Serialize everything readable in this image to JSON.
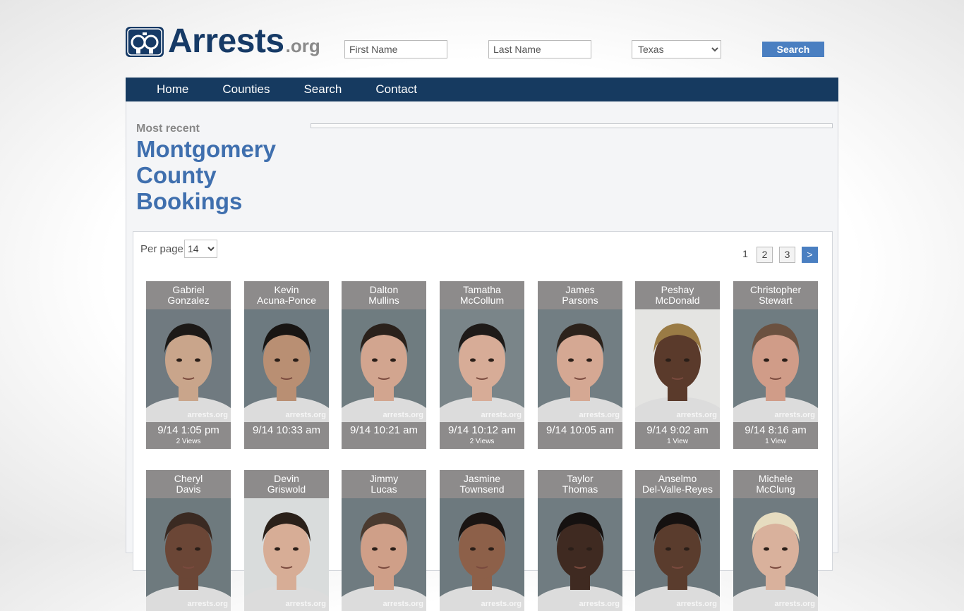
{
  "header": {
    "logo_word": "Arrests",
    "logo_tld": ".org",
    "first_name_placeholder": "First Name",
    "last_name_placeholder": "Last Name",
    "state_selected": "Texas",
    "search_label": "Search"
  },
  "nav": [
    "Home",
    "Counties",
    "Search",
    "Contact"
  ],
  "section": {
    "eyebrow": "Most recent",
    "title_lines": [
      "Montgomery",
      "County",
      "Bookings"
    ]
  },
  "controls": {
    "per_page_label": "Per page",
    "per_page_value": "14",
    "pages": [
      "1",
      "2",
      "3"
    ],
    "next_label": ">"
  },
  "watermark": "arrests.org",
  "colors": {
    "brand_navy": "#163a66",
    "accent_blue": "#4a7fc1",
    "title_blue": "#3f6fae",
    "card_gray": "#8d8b8b"
  },
  "bookings": [
    {
      "first": "Gabriel",
      "last": "Gonzalez",
      "time": "9/14 1:05 pm",
      "views": "2 Views",
      "bg": "#707a80",
      "skin": "#c9a58b",
      "hair": "#1c1917"
    },
    {
      "first": "Kevin",
      "last": "Acuna-Ponce",
      "time": "9/14 10:33 am",
      "views": "",
      "bg": "#6d7a80",
      "skin": "#b98f73",
      "hair": "#181513"
    },
    {
      "first": "Dalton",
      "last": "Mullins",
      "time": "9/14 10:21 am",
      "views": "",
      "bg": "#6f7c80",
      "skin": "#d2a58f",
      "hair": "#2a211b"
    },
    {
      "first": "Tamatha",
      "last": "McCollum",
      "time": "9/14 10:12 am",
      "views": "2 Views",
      "bg": "#7a8589",
      "skin": "#d7ac97",
      "hair": "#1e1a18"
    },
    {
      "first": "James",
      "last": "Parsons",
      "time": "9/14 10:05 am",
      "views": "",
      "bg": "#727e83",
      "skin": "#d5a893",
      "hair": "#2c221b"
    },
    {
      "first": "Peshay",
      "last": "McDonald",
      "time": "9/14 9:02 am",
      "views": "1 View",
      "bg": "#e4e4e2",
      "skin": "#5a3a2b",
      "hair": "#9a7b45"
    },
    {
      "first": "Christopher",
      "last": "Stewart",
      "time": "9/14 8:16 am",
      "views": "1 View",
      "bg": "#6f7c81",
      "skin": "#d09c88",
      "hair": "#6b5140"
    },
    {
      "first": "Cheryl",
      "last": "Davis",
      "time": "",
      "views": "",
      "bg": "#6e7a7e",
      "skin": "#6b4636",
      "hair": "#3a2a22"
    },
    {
      "first": "Devin",
      "last": "Griswold",
      "time": "",
      "views": "",
      "bg": "#d9dcdc",
      "skin": "#d7ad96",
      "hair": "#2a2019"
    },
    {
      "first": "Jimmy",
      "last": "Lucas",
      "time": "",
      "views": "",
      "bg": "#6f7b80",
      "skin": "#cf9f88",
      "hair": "#4a3a2f"
    },
    {
      "first": "Jasmine",
      "last": "Townsend",
      "time": "",
      "views": "",
      "bg": "#6d797e",
      "skin": "#8d6049",
      "hair": "#1a1412"
    },
    {
      "first": "Taylor",
      "last": "Thomas",
      "time": "",
      "views": "",
      "bg": "#707c81",
      "skin": "#3f2a21",
      "hair": "#151110"
    },
    {
      "first": "Anselmo",
      "last": "Del-Valle-Reyes",
      "time": "",
      "views": "",
      "bg": "#6c787d",
      "skin": "#5a3c2d",
      "hair": "#151110"
    },
    {
      "first": "Michele",
      "last": "McClung",
      "time": "",
      "views": "",
      "bg": "#707b80",
      "skin": "#d9b19c",
      "hair": "#e6dcc0"
    }
  ]
}
